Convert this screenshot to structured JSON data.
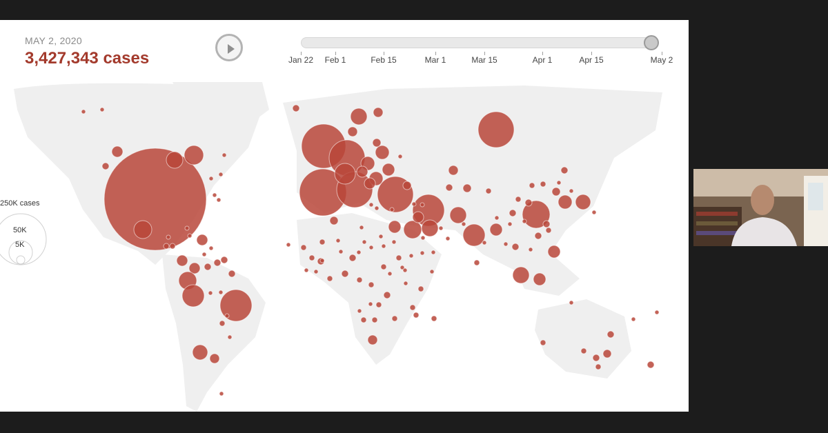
{
  "header": {
    "date": "MAY 2, 2020",
    "cases": "3,427,343 cases"
  },
  "timeline": {
    "ticks": [
      "Jan 22",
      "Feb 1",
      "Feb 15",
      "Mar 1",
      "Mar 15",
      "Apr 1",
      "Apr 15",
      "May 2"
    ],
    "current": "May 2"
  },
  "legend": {
    "large": "250K cases",
    "medium": "50K",
    "small": "5K"
  },
  "colors": {
    "bubble": "#b9473a",
    "accent_text": "#a33a2c"
  },
  "icons": {
    "play": "play-icon"
  }
}
